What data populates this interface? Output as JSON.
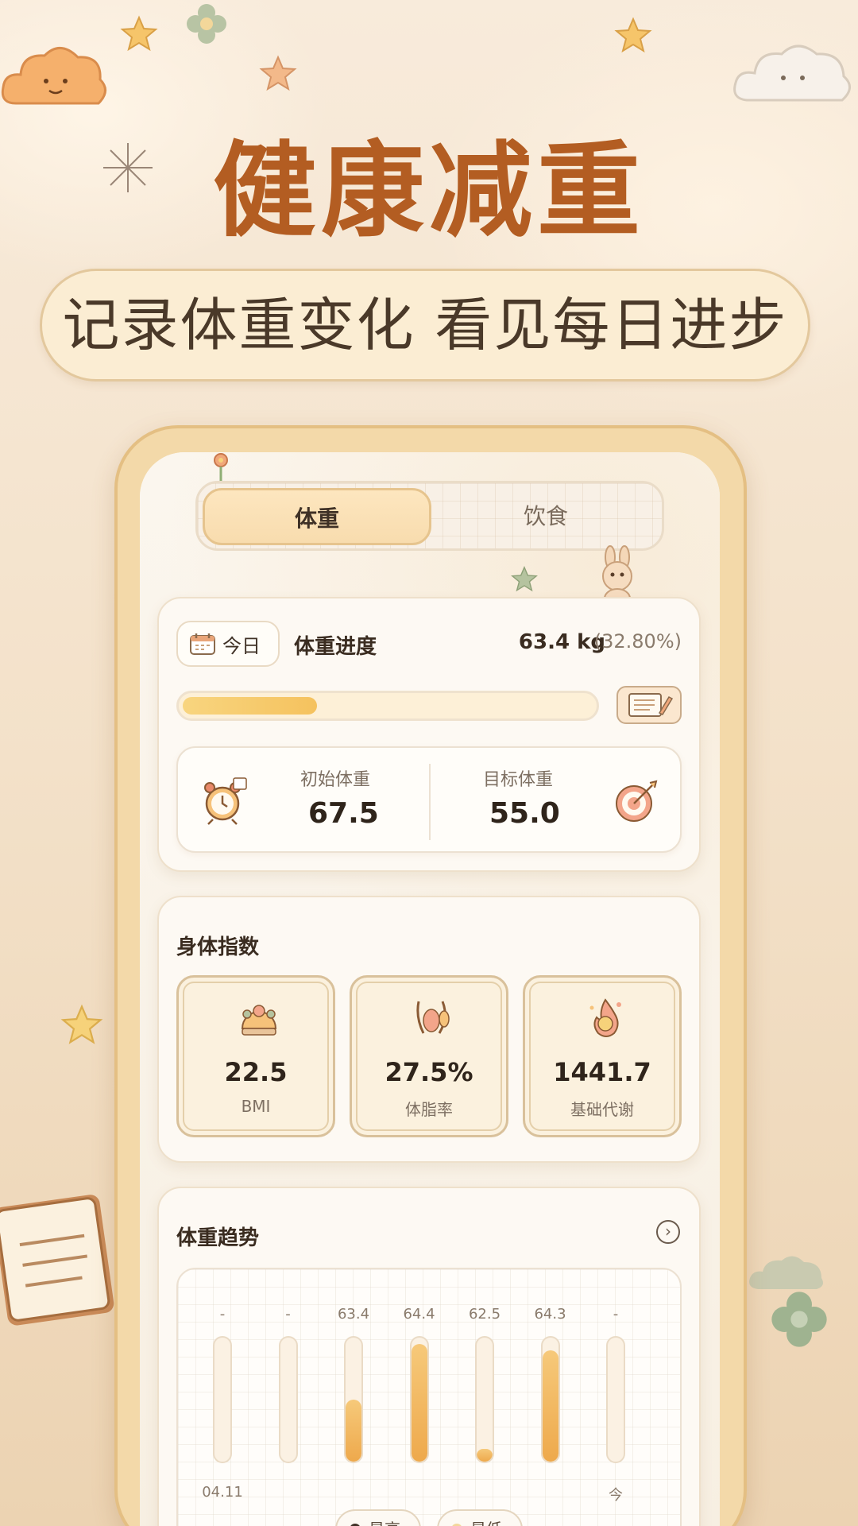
{
  "promo": {
    "headline": "健康减重",
    "subheadline": "记录体重变化 看见每日进步"
  },
  "tabs": [
    {
      "label": "体重",
      "active": true
    },
    {
      "label": "饮食",
      "active": false
    }
  ],
  "progress_card": {
    "date_chip": "今日",
    "title": "体重进度",
    "current_weight": "63.4 kg",
    "percent": "(32.80%)",
    "progress_fraction": 0.328,
    "initial_label": "初始体重",
    "initial_value": "67.5",
    "target_label": "目标体重",
    "target_value": "55.0"
  },
  "body_index_card": {
    "title": "身体指数",
    "items": [
      {
        "value": "22.5",
        "label": "BMI"
      },
      {
        "value": "27.5%",
        "label": "体脂率"
      },
      {
        "value": "1441.7",
        "label": "基础代谢"
      }
    ]
  },
  "trend_card": {
    "title": "体重趋势",
    "bars": [
      {
        "top_label": "-",
        "fill": 0
      },
      {
        "top_label": "-",
        "fill": 0
      },
      {
        "top_label": "63.4",
        "fill": 0.5
      },
      {
        "top_label": "64.4",
        "fill": 0.95
      },
      {
        "top_label": "62.5",
        "fill": 0.1
      },
      {
        "top_label": "64.3",
        "fill": 0.9
      },
      {
        "top_label": "-",
        "fill": 0
      }
    ],
    "x_labels": [
      "04.11",
      "今"
    ],
    "legend": [
      "最高",
      "最低"
    ]
  },
  "colors": {
    "headline": "#b35d22",
    "accent": "#f5c25e",
    "background": "#f6e7d3"
  }
}
